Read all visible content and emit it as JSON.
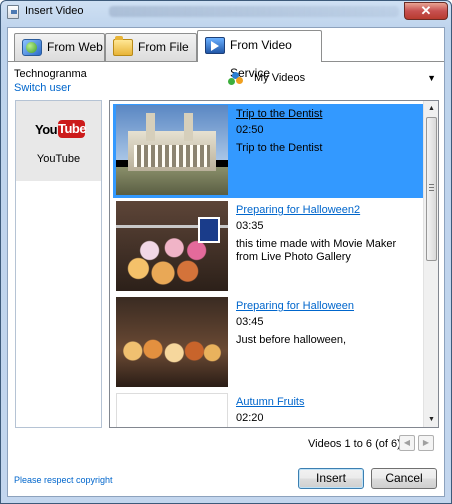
{
  "window": {
    "title": "Insert Video",
    "close_symbol": "✕"
  },
  "tabs": [
    {
      "label": "From Web",
      "icon": "globe-icon"
    },
    {
      "label": "From File",
      "icon": "folder-icon"
    },
    {
      "label": "From Video Service",
      "icon": "video-service-icon",
      "selected": true
    }
  ],
  "account": {
    "name": "Technogranma",
    "switch_label": "Switch user"
  },
  "provider_dropdown": {
    "value": "My Videos",
    "icon": "my-videos-icon"
  },
  "providers": [
    {
      "name": "YouTube",
      "logo_you": "You",
      "logo_tube": "Tube",
      "selected": true
    }
  ],
  "videos": [
    {
      "title": "Trip to the Dentist",
      "duration": "02:50",
      "description": "Trip to the Dentist",
      "selected": true
    },
    {
      "title": "Preparing for Halloween2",
      "duration": "03:35",
      "description": "this time made with Movie Maker from Live Photo Gallery"
    },
    {
      "title": "Preparing for Halloween",
      "duration": "03:45",
      "description": "Just before halloween,"
    },
    {
      "title": "Autumn Fruits",
      "duration": "02:20",
      "description": ""
    }
  ],
  "pager": {
    "text": "Videos 1 to 6 (of 6)"
  },
  "footer": {
    "copyright": "Please respect copyright",
    "insert_label": "Insert",
    "cancel_label": "Cancel"
  },
  "colors": {
    "selection": "#3399ff",
    "link": "#0066cc",
    "frame": "#bdd3ec"
  }
}
